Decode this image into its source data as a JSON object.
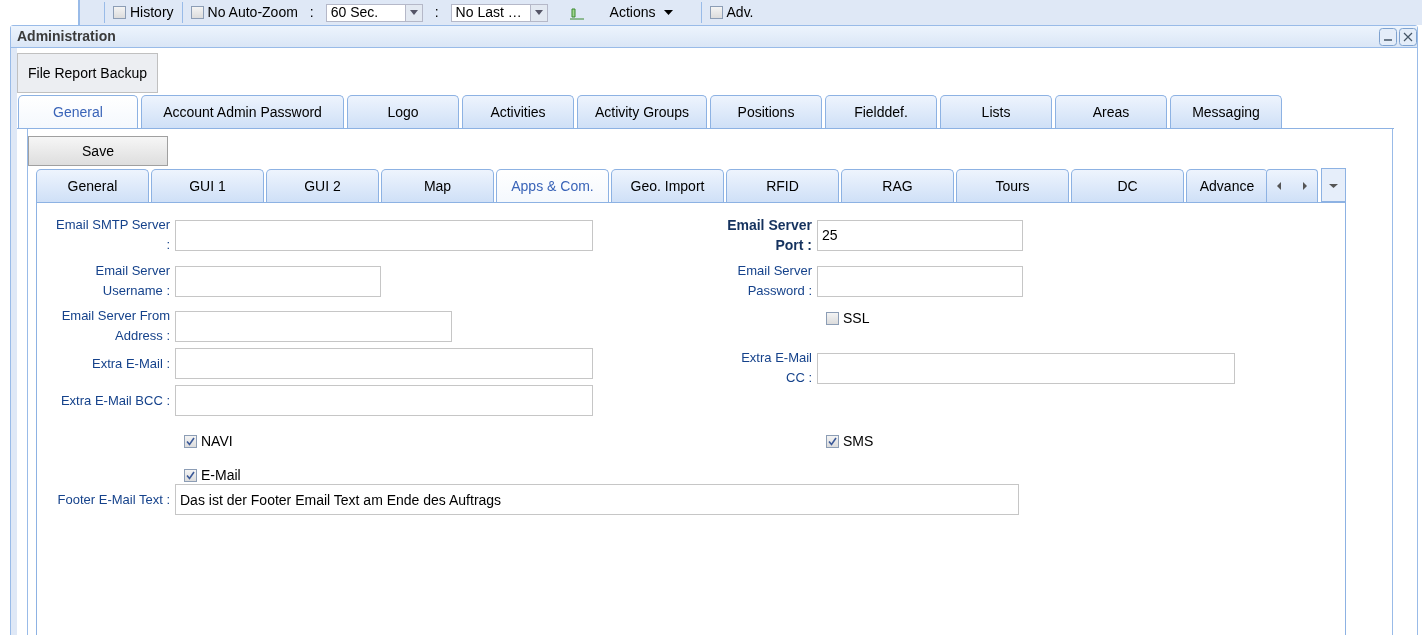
{
  "toolbar": {
    "items": [
      {
        "kind": "checkbox",
        "label": "History",
        "checked": false
      },
      {
        "kind": "checkbox",
        "label": "No Auto-Zoom",
        "checked": false
      },
      {
        "kind": "text",
        "label": ":"
      },
      {
        "kind": "combo",
        "label": "60 Sec."
      },
      {
        "kind": "text",
        "label": ":"
      },
      {
        "kind": "combo",
        "label": "No Last …"
      },
      {
        "kind": "menu",
        "label": "Actions"
      },
      {
        "kind": "checkbox",
        "label": "Adv.",
        "checked": false
      }
    ]
  },
  "window": {
    "title": "Administration"
  },
  "top_tabs": [
    {
      "label": "File Report Backup",
      "selected": true
    }
  ],
  "main_tabs": [
    {
      "label": "General",
      "selected": true
    },
    {
      "label": "Account Admin Password",
      "selected": false
    },
    {
      "label": "Logo",
      "selected": false
    },
    {
      "label": "Activities",
      "selected": false
    },
    {
      "label": "Activity Groups",
      "selected": false
    },
    {
      "label": "Positions",
      "selected": false
    },
    {
      "label": "Fielddef.",
      "selected": false
    },
    {
      "label": "Lists",
      "selected": false
    },
    {
      "label": "Areas",
      "selected": false
    },
    {
      "label": "Messaging",
      "selected": false
    }
  ],
  "save_button": "Save",
  "sub_tabs": [
    {
      "label": "General",
      "selected": false
    },
    {
      "label": "GUI 1",
      "selected": false
    },
    {
      "label": "GUI 2",
      "selected": false
    },
    {
      "label": "Map",
      "selected": false
    },
    {
      "label": "Apps & Com.",
      "selected": true
    },
    {
      "label": "Geo. Import",
      "selected": false
    },
    {
      "label": "RFID",
      "selected": false
    },
    {
      "label": "RAG",
      "selected": false
    },
    {
      "label": "Tours",
      "selected": false
    },
    {
      "label": "DC",
      "selected": false
    },
    {
      "label": "Advance",
      "selected": false
    }
  ],
  "form_rows": [
    {
      "left": {
        "kind": "field",
        "label": "Email SMTP Server :"
      },
      "right": {
        "kind": "field",
        "label": "Email Server Port :",
        "value": "25",
        "required": true
      }
    },
    {
      "left": {
        "kind": "field",
        "label": "Email Server Username :"
      },
      "right": {
        "kind": "field",
        "label": "Email Server Password :"
      }
    },
    {
      "left": {
        "kind": "field",
        "label": "Email Server From Address :"
      },
      "right": {
        "kind": "checkbox",
        "label": "SSL",
        "checked": false
      }
    },
    {
      "left": {
        "kind": "field",
        "label": "Extra E-Mail :"
      },
      "right": {
        "kind": "field",
        "label": "Extra E-Mail CC :"
      }
    },
    {
      "left": {
        "kind": "field",
        "label": "Extra E-Mail BCC :"
      }
    },
    {
      "left": {
        "kind": "checkbox",
        "label": "NAVI",
        "checked": true
      },
      "right": {
        "kind": "checkbox",
        "label": "SMS",
        "checked": true
      }
    },
    {
      "left": {
        "kind": "checkbox",
        "label": "E-Mail",
        "checked": true
      }
    },
    {
      "left": {
        "kind": "field",
        "label": "Footer E-Mail Text :",
        "value": "Das ist der Footer Email Text am Ende des Auftrags"
      }
    }
  ]
}
